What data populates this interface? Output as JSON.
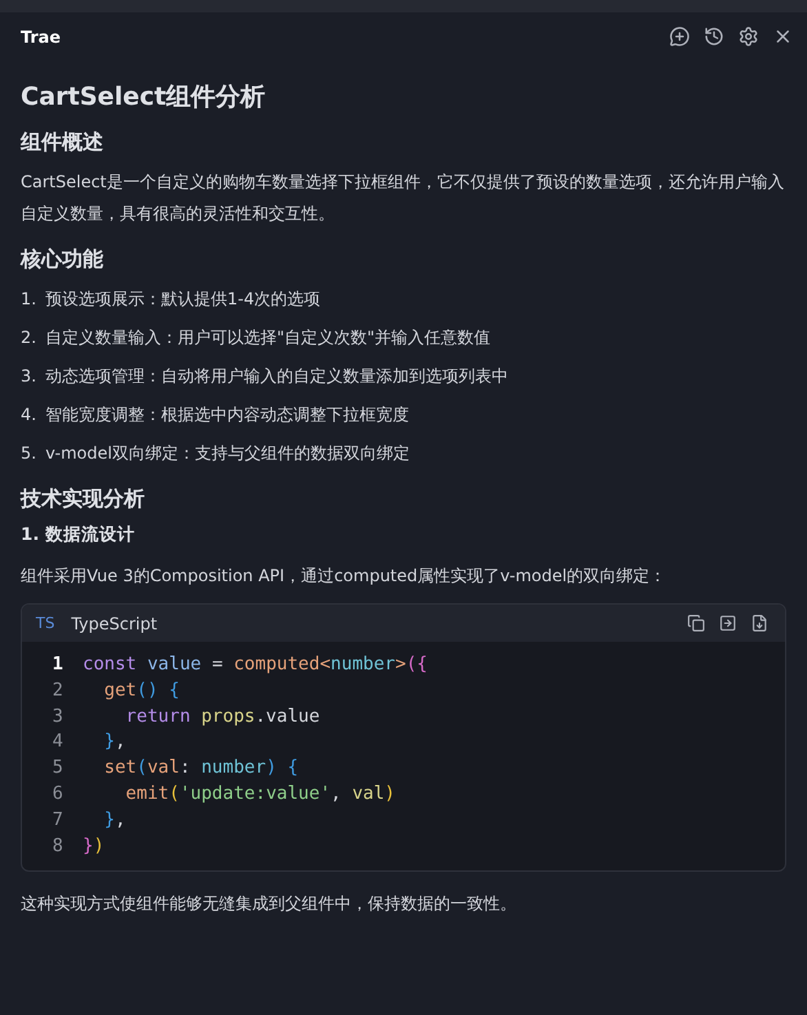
{
  "panel": {
    "title": "Trae",
    "actions": [
      {
        "kind": "new-chat"
      },
      {
        "kind": "history"
      },
      {
        "kind": "settings"
      },
      {
        "kind": "close"
      }
    ]
  },
  "document": {
    "title": "CartSelect组件分析",
    "sections": [
      {
        "kind": "h2",
        "text": "组件概述"
      },
      {
        "kind": "p",
        "text": "CartSelect是一个自定义的购物车数量选择下拉框组件，它不仅提供了预设的数量选项，还允许用户输入自定义数量，具有很高的灵活性和交互性。"
      },
      {
        "kind": "h2",
        "text": "核心功能"
      },
      {
        "kind": "ol",
        "items": [
          {
            "num": "1.",
            "text": "预设选项展示：默认提供1-4次的选项"
          },
          {
            "num": "2.",
            "text": "自定义数量输入：用户可以选择\"自定义次数\"并输入任意数值"
          },
          {
            "num": "3.",
            "text": "动态选项管理：自动将用户输入的自定义数量添加到选项列表中"
          },
          {
            "num": "4.",
            "text": "智能宽度调整：根据选中内容动态调整下拉框宽度"
          },
          {
            "num": "5.",
            "text": "v-model双向绑定：支持与父组件的数据双向绑定"
          }
        ]
      },
      {
        "kind": "h2",
        "text": "技术实现分析"
      },
      {
        "kind": "h3",
        "text": "1. 数据流设计"
      },
      {
        "kind": "p",
        "text": "组件采用Vue 3的Composition API，通过computed属性实现了v-model的双向绑定："
      },
      {
        "kind": "code",
        "badge": "TS",
        "language": "TypeScript",
        "lines": [
          {
            "num": "1",
            "current": true,
            "tokens": [
              {
                "text": "const",
                "kind": "keyword"
              },
              {
                "text": " value ",
                "kind": "variable"
              },
              {
                "text": "= ",
                "kind": "plain"
              },
              {
                "text": "computed",
                "kind": "function"
              },
              {
                "text": "<",
                "kind": "function"
              },
              {
                "text": "number",
                "kind": "type"
              },
              {
                "text": ">",
                "kind": "function"
              },
              {
                "text": "({",
                "kind": "bracket1"
              }
            ]
          },
          {
            "num": "2",
            "current": false,
            "tokens": [
              {
                "text": "  get",
                "kind": "function"
              },
              {
                "text": "() {",
                "kind": "bracket3"
              }
            ]
          },
          {
            "num": "3",
            "current": false,
            "tokens": [
              {
                "text": "    return ",
                "kind": "keyword"
              },
              {
                "text": "props",
                "kind": "object"
              },
              {
                "text": ".value",
                "kind": "plain"
              }
            ]
          },
          {
            "num": "4",
            "current": false,
            "tokens": [
              {
                "text": "  }",
                "kind": "bracket3"
              },
              {
                "text": ",",
                "kind": "plain"
              }
            ]
          },
          {
            "num": "5",
            "current": false,
            "tokens": [
              {
                "text": "  set",
                "kind": "function"
              },
              {
                "text": "(",
                "kind": "bracket3"
              },
              {
                "text": "val",
                "kind": "function"
              },
              {
                "text": ": ",
                "kind": "plain"
              },
              {
                "text": "number",
                "kind": "type"
              },
              {
                "text": ") {",
                "kind": "bracket3"
              }
            ]
          },
          {
            "num": "6",
            "current": false,
            "tokens": [
              {
                "text": "    emit",
                "kind": "function"
              },
              {
                "text": "(",
                "kind": "bracket2"
              },
              {
                "text": "'update:value'",
                "kind": "string"
              },
              {
                "text": ", ",
                "kind": "plain"
              },
              {
                "text": "val",
                "kind": "object"
              },
              {
                "text": ")",
                "kind": "bracket2"
              }
            ]
          },
          {
            "num": "7",
            "current": false,
            "tokens": [
              {
                "text": "  }",
                "kind": "bracket3"
              },
              {
                "text": ",",
                "kind": "plain"
              }
            ]
          },
          {
            "num": "8",
            "current": false,
            "tokens": [
              {
                "text": "}",
                "kind": "bracket1"
              },
              {
                "text": ")",
                "kind": "bracket2"
              }
            ]
          }
        ]
      },
      {
        "kind": "p",
        "text": "这种实现方式使组件能够无缝集成到父组件中，保持数据的一致性。"
      }
    ]
  }
}
